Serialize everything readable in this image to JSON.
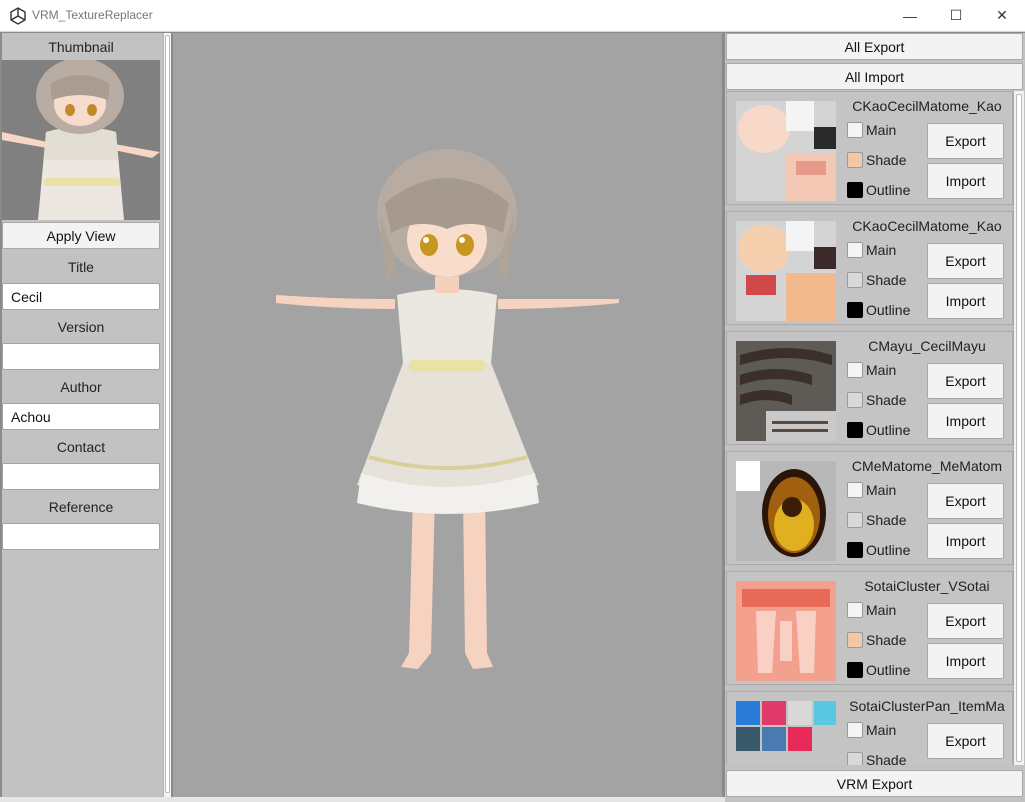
{
  "window": {
    "title": "VRM_TextureReplacer",
    "minimize_glyph": "—",
    "maximize_glyph": "☐",
    "close_glyph": "✕"
  },
  "left": {
    "thumbnail_label": "Thumbnail",
    "apply_view": "Apply View",
    "fields": [
      {
        "label": "Title",
        "value": "Cecil"
      },
      {
        "label": "Version",
        "value": ""
      },
      {
        "label": "Author",
        "value": "Achou"
      },
      {
        "label": "Contact",
        "value": ""
      },
      {
        "label": "Reference",
        "value": ""
      }
    ]
  },
  "right": {
    "all_export": "All Export",
    "all_import": "All Import",
    "vrm_export": "VRM Export",
    "check_labels": {
      "main": "Main",
      "shade": "Shade",
      "outline": "Outline"
    },
    "export_label": "Export",
    "import_label": "Import",
    "materials": [
      {
        "name": "CKaoCecilMatome_Kao",
        "shade_color": "#f3c8a6",
        "outline_color": "#000000"
      },
      {
        "name": "CKaoCecilMatome_Kao",
        "shade_color": "#d9d9d9",
        "outline_color": "#000000"
      },
      {
        "name": "CMayu_CecilMayu",
        "shade_color": "#d9d9d9",
        "outline_color": "#000000"
      },
      {
        "name": "CMeMatome_MeMatom",
        "shade_color": "#d9d9d9",
        "outline_color": "#000000"
      },
      {
        "name": "SotaiCluster_VSotai",
        "shade_color": "#f3c8a6",
        "outline_color": "#000000"
      },
      {
        "name": "SotaiClusterPan_ItemMa",
        "shade_color": "#d9d9d9",
        "outline_color": "#000000"
      }
    ]
  }
}
